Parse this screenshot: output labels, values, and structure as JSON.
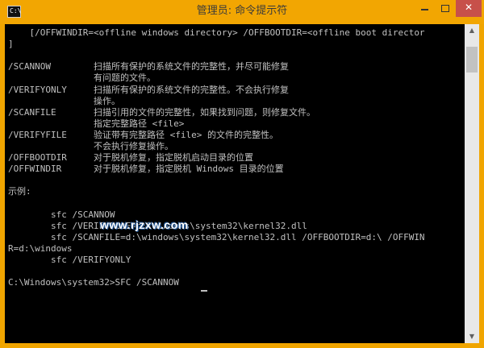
{
  "window": {
    "title": "管理员: 命令提示符",
    "icon_label": "C:\\"
  },
  "controls": {
    "close_glyph": "✕"
  },
  "console": {
    "lines": [
      "    [/OFFWINDIR=<offline windows directory> /OFFBOOTDIR=<offline boot director",
      "]",
      "",
      "/SCANNOW        扫描所有保护的系统文件的完整性，并尽可能修复",
      "                有问题的文件。",
      "/VERIFYONLY     扫描所有保护的系统文件的完整性。不会执行修复",
      "                操作。",
      "/SCANFILE       扫描引用的文件的完整性，如果找到问题，则修复文件。",
      "                指定完整路径 <file>",
      "/VERIFYFILE     验证带有完整路径 <file> 的文件的完整性。",
      "                不会执行修复操作。",
      "/OFFBOOTDIR     对于脱机修复，指定脱机启动目录的位置",
      "/OFFWINDIR      对于脱机修复，指定脱机 Windows 目录的位置",
      "",
      "示例:",
      "",
      "        sfc /SCANNOW",
      "        sfc /VERIFYFILE=c:\\windows\\system32\\kernel32.dll",
      "        sfc /SCANFILE=d:\\windows\\system32\\kernel32.dll /OFFBOOTDIR=d:\\ /OFFWIN",
      "R=d:\\windows",
      "        sfc /VERIFYONLY",
      "",
      "C:\\Windows\\system32>SFC /SCANNOW"
    ]
  },
  "watermark": "www.rjzxw.com",
  "scrollbar": {
    "up_glyph": "▲",
    "down_glyph": "▼"
  }
}
